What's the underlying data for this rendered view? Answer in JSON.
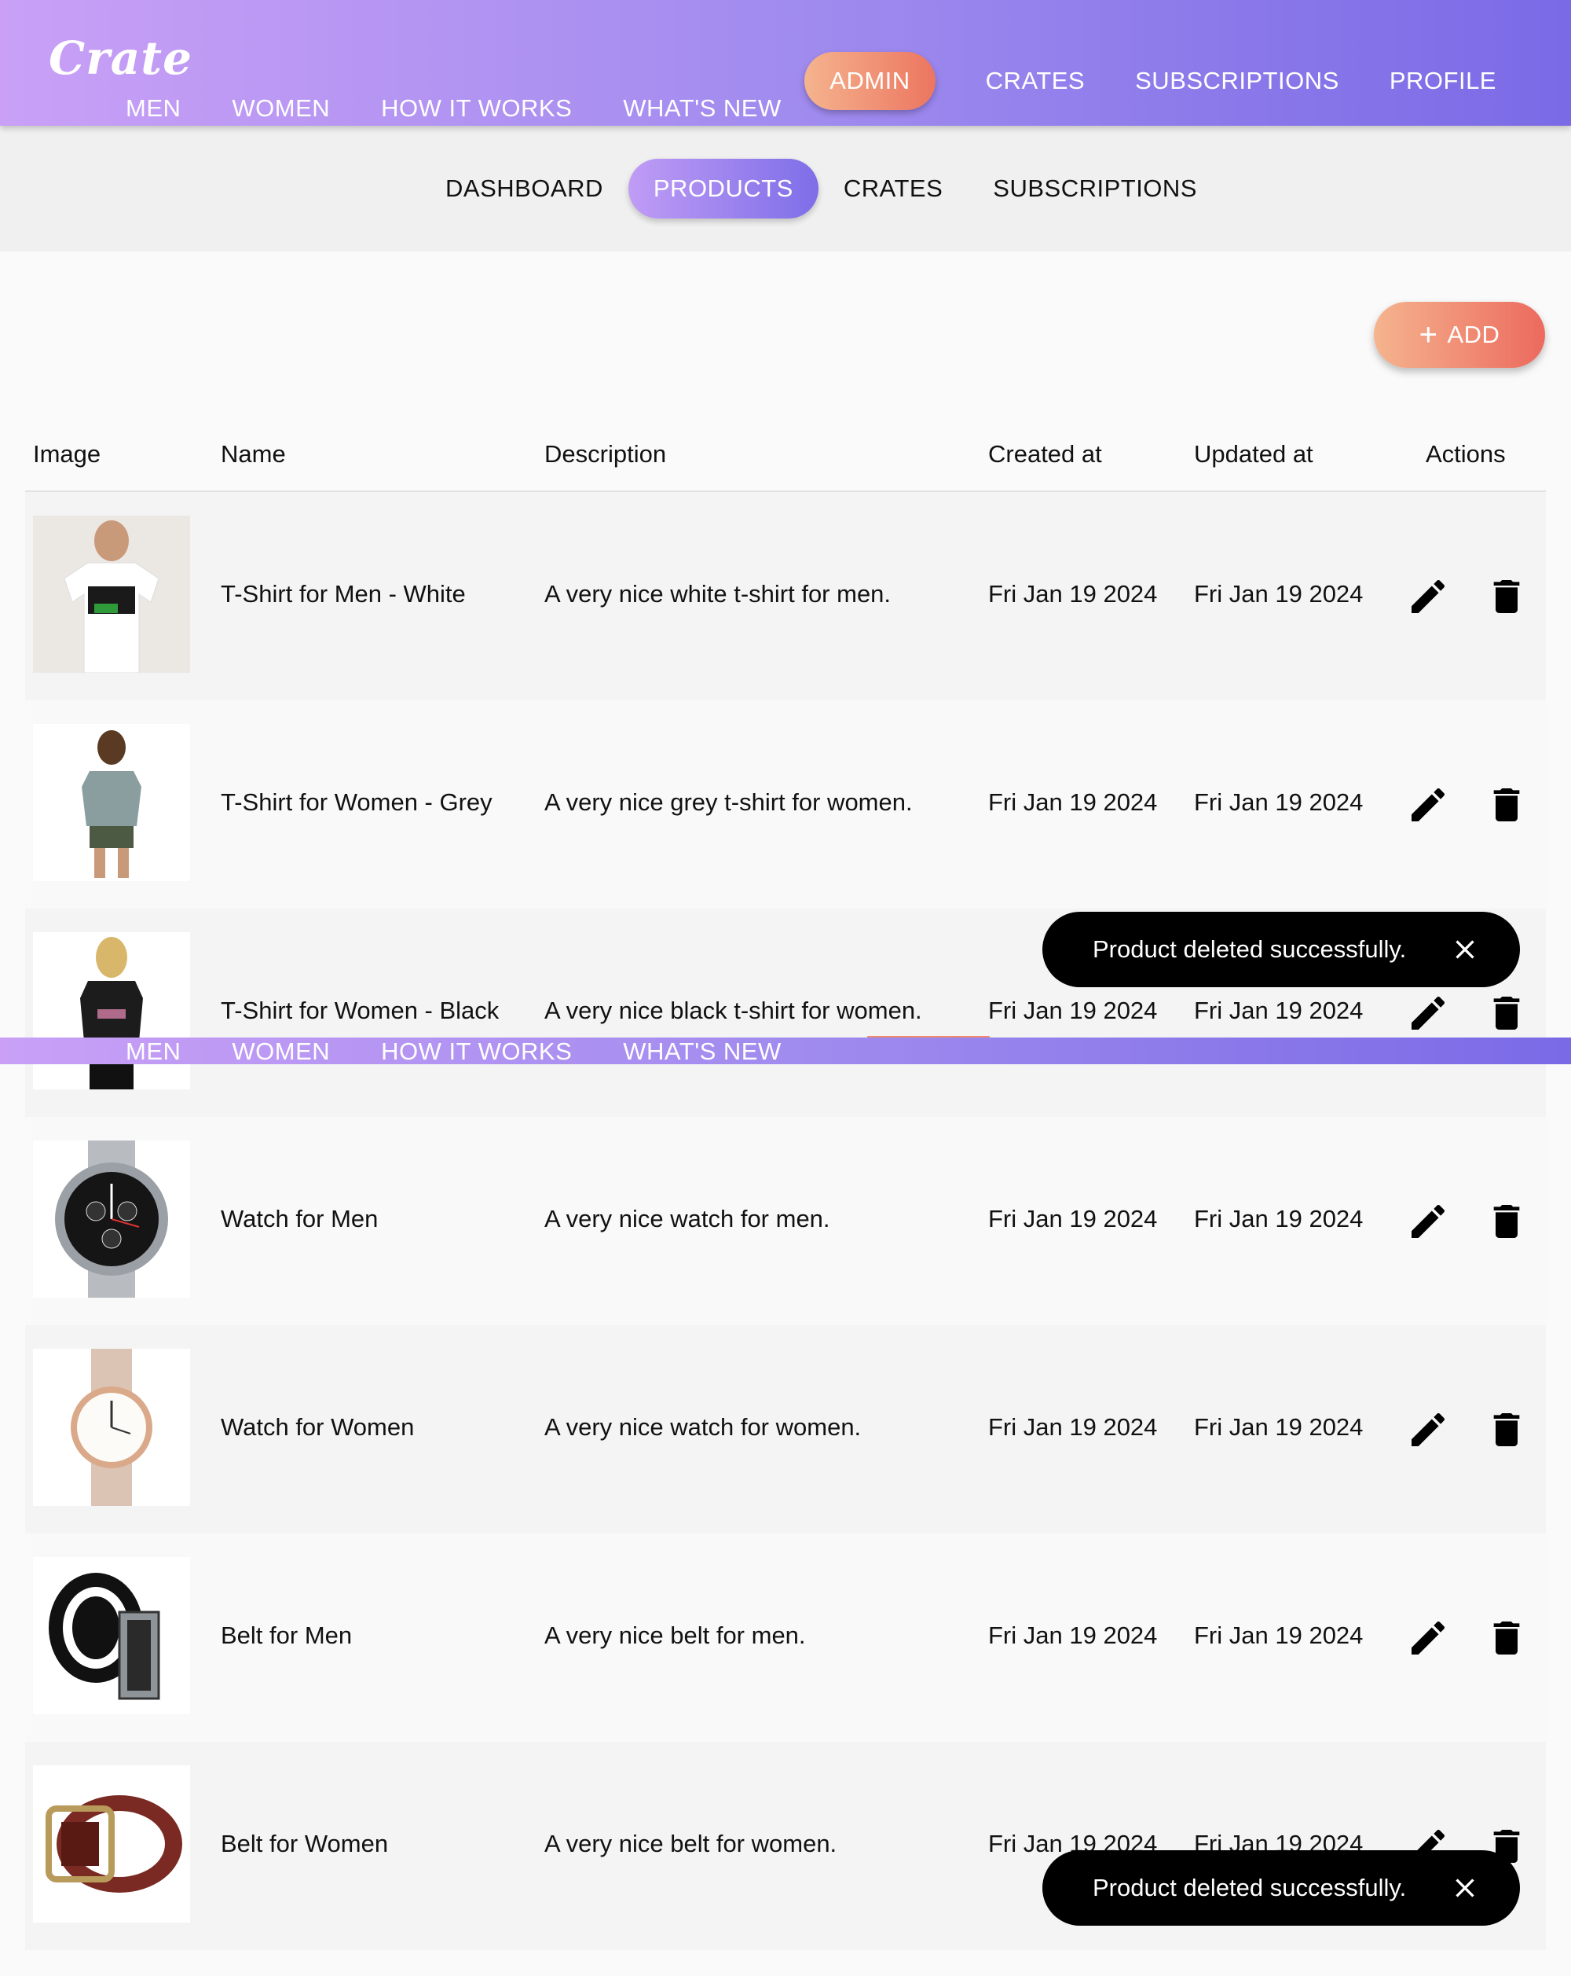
{
  "brand": {
    "logo": "Crate"
  },
  "header": {
    "categories": [
      "MEN",
      "WOMEN",
      "HOW IT WORKS",
      "WHAT'S NEW"
    ],
    "admin_label": "ADMIN",
    "links": [
      "CRATES",
      "SUBSCRIPTIONS",
      "PROFILE"
    ]
  },
  "subnav": {
    "tabs": [
      "DASHBOARD",
      "PRODUCTS",
      "CRATES",
      "SUBSCRIPTIONS"
    ],
    "active": "PRODUCTS"
  },
  "add_button": {
    "label": "ADD",
    "icon": "plus-icon"
  },
  "table": {
    "columns": [
      "Image",
      "Name",
      "Description",
      "Created at",
      "Updated at",
      "Actions"
    ],
    "rows": [
      {
        "image": "tshirt-men-white",
        "name": "T-Shirt for Men - White",
        "description": "A very nice white t-shirt for men.",
        "created_at": "Fri Jan 19 2024",
        "updated_at": "Fri Jan 19 2024"
      },
      {
        "image": "tshirt-women-grey",
        "name": "T-Shirt for Women - Grey",
        "description": "A very nice grey t-shirt for women.",
        "created_at": "Fri Jan 19 2024",
        "updated_at": "Fri Jan 19 2024"
      },
      {
        "image": "tshirt-women-black",
        "name": "T-Shirt for Women - Black",
        "description": "A very nice black t-shirt for women.",
        "created_at": "Fri Jan 19 2024",
        "updated_at": "Fri Jan 19 2024"
      },
      {
        "image": "watch-men",
        "name": "Watch for Men",
        "description": "A very nice watch for men.",
        "created_at": "Fri Jan 19 2024",
        "updated_at": "Fri Jan 19 2024"
      },
      {
        "image": "watch-women",
        "name": "Watch for Women",
        "description": "A very nice watch for women.",
        "created_at": "Fri Jan 19 2024",
        "updated_at": "Fri Jan 19 2024"
      },
      {
        "image": "belt-men",
        "name": "Belt for Men",
        "description": "A very nice belt for men.",
        "created_at": "Fri Jan 19 2024",
        "updated_at": "Fri Jan 19 2024"
      },
      {
        "image": "belt-women",
        "name": "Belt for Women",
        "description": "A very nice belt for women.",
        "created_at": "Fri Jan 19 2024",
        "updated_at": "Fri Jan 19 2024"
      }
    ],
    "action_icons": [
      "pencil-icon",
      "trash-icon"
    ]
  },
  "toasts": [
    {
      "message": "Product deleted successfully.",
      "close_icon": "close-icon"
    },
    {
      "message": "Product deleted successfully.",
      "close_icon": "close-icon"
    }
  ],
  "colors": {
    "header_gradient_start": "#c9a0f6",
    "header_gradient_end": "#7a6ae6",
    "accent_orange_start": "#f5b48e",
    "accent_orange_end": "#ec6a5e",
    "toast_bg": "#000000"
  }
}
